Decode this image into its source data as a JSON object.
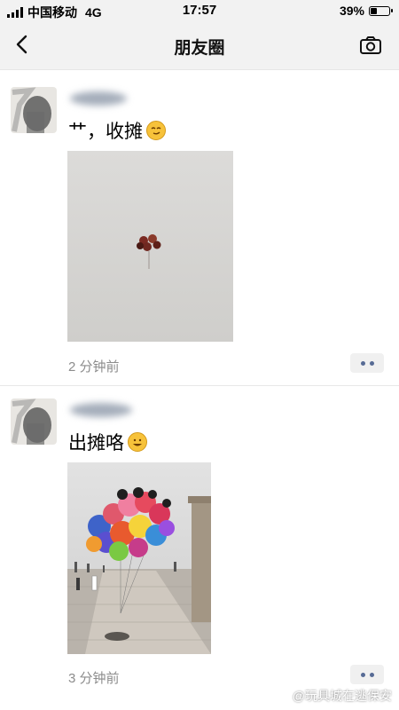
{
  "status_bar": {
    "carrier": "中国移动",
    "network": "4G",
    "time": "17:57",
    "battery_percent": "39%",
    "battery_level": 0.39
  },
  "nav": {
    "title": "朋友圈",
    "back_icon": "chevron-left-icon",
    "camera_icon": "camera-icon"
  },
  "posts": [
    {
      "text": "艹，收摊",
      "emoji": "smirk-emoji",
      "time": "2 分钟前",
      "image": "single-balloon-bunch-in-sky"
    },
    {
      "text": "出摊咯",
      "emoji": "grin-emoji",
      "time": "3 分钟前",
      "image": "cartoon-balloons-on-pavement"
    }
  ],
  "watermark": {
    "text": "@玩具城在逃保安"
  }
}
